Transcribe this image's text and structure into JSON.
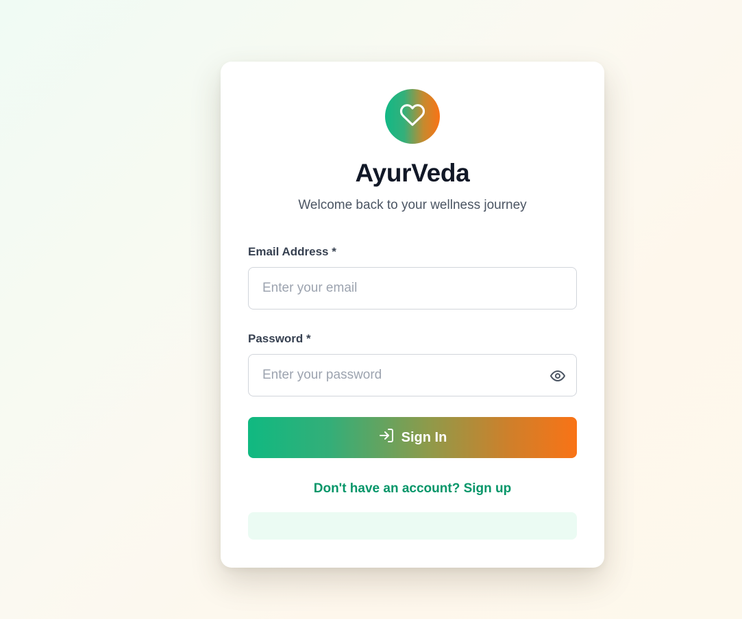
{
  "brand": {
    "name": "AyurVeda",
    "tagline": "Welcome back to your wellness journey",
    "logo_icon": "heart-icon"
  },
  "form": {
    "email": {
      "label": "Email Address *",
      "placeholder": "Enter your email",
      "value": ""
    },
    "password": {
      "label": "Password *",
      "placeholder": "Enter your password",
      "value": "",
      "toggle_icon": "eye-icon"
    },
    "submit": {
      "label": "Sign In",
      "icon": "sign-in-icon"
    },
    "signup_link": "Don't have an account? Sign up",
    "notice_text": ""
  },
  "colors": {
    "gradient_start": "#10b981",
    "gradient_end": "#f97316",
    "link": "#059669",
    "notice_bg": "#ebfbf3"
  }
}
